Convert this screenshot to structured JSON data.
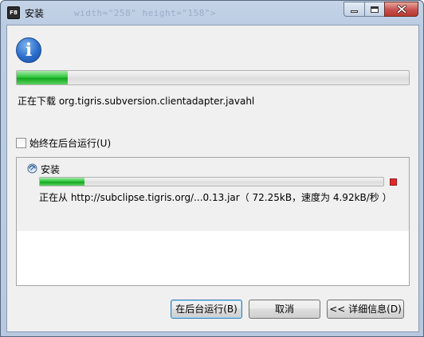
{
  "window": {
    "title": "安装",
    "app_icon_text": "F8",
    "ghost_text": "width=\"258\" height=\"158\">"
  },
  "main_progress": {
    "fraction": 0.13
  },
  "status": {
    "download_text": "正在下载 org.tigris.subversion.clientadapter.javahl"
  },
  "checkbox": {
    "label": "始终在后台运行(U)",
    "checked": false
  },
  "job": {
    "label": "安装",
    "progress_fraction": 0.13,
    "status_text": "正在从 http://subclipse.tigris.org/...0.13.jar（ 72.25kB，速度为 4.92kB/秒 ）"
  },
  "buttons": {
    "background": "在后台运行(B)",
    "cancel": "取消",
    "details": "<< 详细信息(D)"
  },
  "colors": {
    "progress_green": "#34c840",
    "stop_red": "#e02a2a",
    "close_red": "#c75050"
  },
  "icons": [
    "info-icon",
    "job-icon",
    "stop-icon",
    "minimize-icon",
    "maximize-icon",
    "close-icon"
  ]
}
